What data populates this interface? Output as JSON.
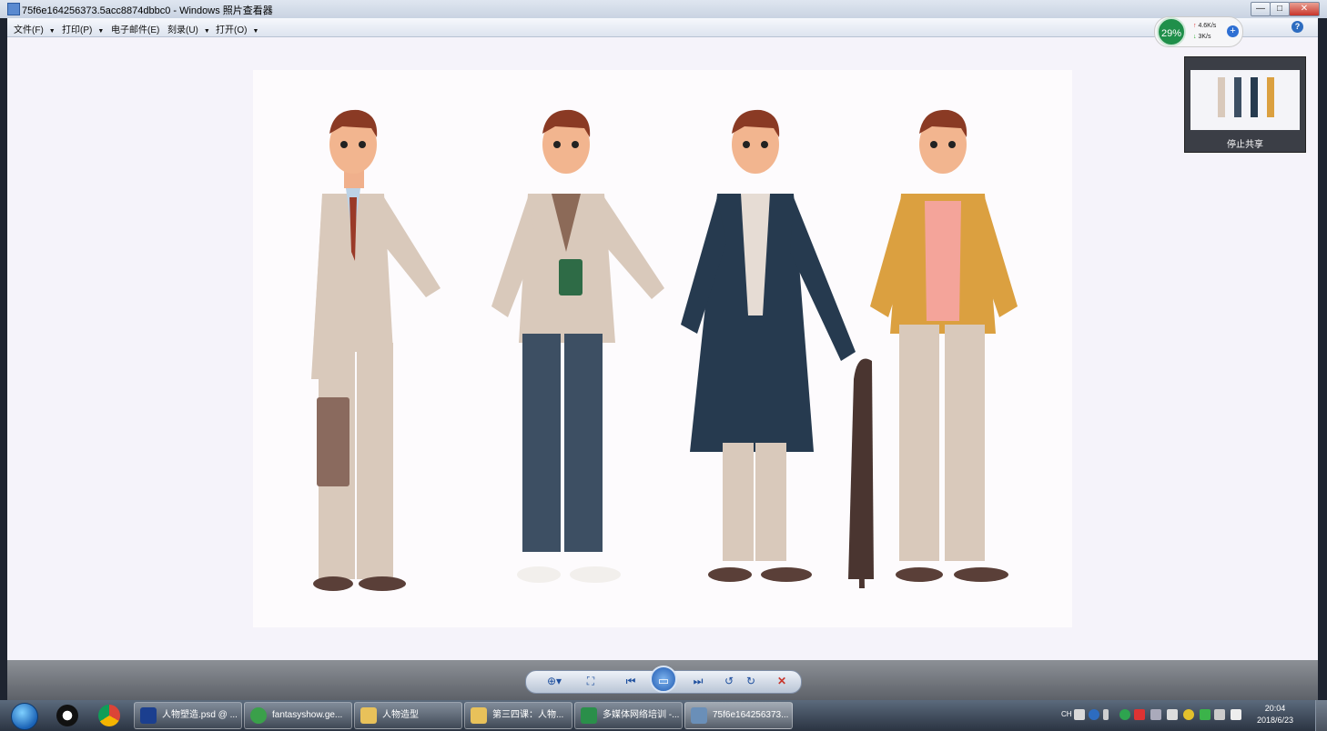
{
  "window": {
    "title": "75f6e164256373.5acc8874dbbc0 - Windows 照片查看器",
    "controls": {
      "minimize": "—",
      "maximize": "□",
      "close": "✕"
    }
  },
  "menu": {
    "items": [
      "文件(F)",
      "打印(P)",
      "电子邮件(E)",
      "刻录(U)",
      "打开(O)"
    ],
    "help": "?"
  },
  "net_monitor": {
    "percent": "29%",
    "upload": "4.6K/s",
    "download": "3K/s",
    "plus": "+"
  },
  "share_panel": {
    "label": "停止共享"
  },
  "image": {
    "figures": [
      {
        "outfit": "beige suit",
        "accessory": "briefcase",
        "colors": {
          "jacket": "#d9c9bb",
          "pants": "#d9c9bb",
          "tie": "#9a3a28",
          "shoes": "#5a3f38"
        }
      },
      {
        "outfit": "blazer and jeans",
        "accessory": "coffee cup",
        "colors": {
          "jacket": "#d9c9bb",
          "pants": "#3d4f63",
          "shoes": "#f2efec"
        }
      },
      {
        "outfit": "navy overcoat",
        "accessory": "umbrella",
        "colors": {
          "jacket": "#263a4f",
          "pants": "#d9c9bb",
          "shoes": "#5a3f38"
        }
      },
      {
        "outfit": "mustard jacket",
        "accessory": "none",
        "colors": {
          "jacket": "#dba040",
          "shirt": "#f4a49a",
          "pants": "#d9c9bb",
          "shoes": "#5a3f38"
        }
      }
    ]
  },
  "viewer_controls": {
    "zoom": "zoom-icon",
    "actual_size": "fit-window-icon",
    "previous": "previous-icon",
    "slideshow": "slideshow-icon",
    "next": "next-icon",
    "rotate_ccw": "rotate-ccw-icon",
    "rotate_cw": "rotate-cw-icon",
    "delete": "delete-icon"
  },
  "taskbar": {
    "tasks": [
      {
        "label": "人物塑造.psd @ ...",
        "color": "#1b3f8f"
      },
      {
        "label": "fantasyshow.ge...",
        "color": "#3aa04a"
      },
      {
        "label": "人物造型",
        "color": "#e8c15a"
      },
      {
        "label": "第三四课：人物...",
        "color": "#e8c15a"
      },
      {
        "label": "多媒体网络培训 -...",
        "color": "#2a8f4a"
      },
      {
        "label": "75f6e164256373...",
        "color": "#6a8fb8"
      }
    ],
    "language": "CH",
    "time": "20:04",
    "date": "2018/6/23"
  },
  "colors": {
    "accent": "#1d58b0",
    "net_green": "#1f8f4a",
    "close_red": "#c8352b"
  }
}
